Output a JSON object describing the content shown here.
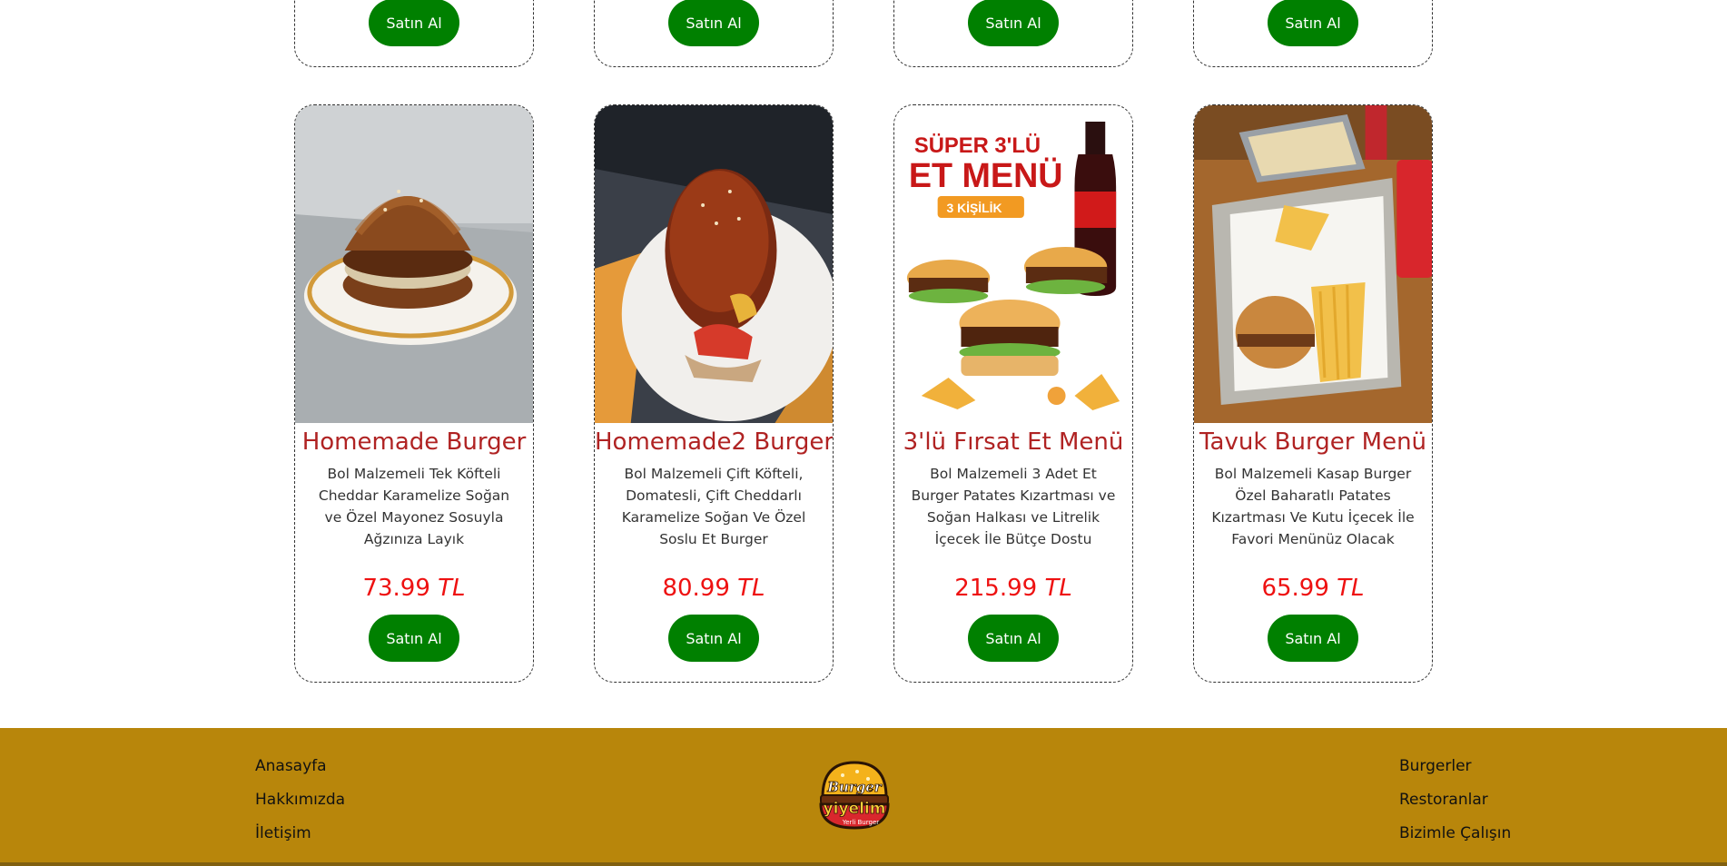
{
  "top_cards": [
    {
      "button": "Satın Al"
    },
    {
      "button": "Satın Al"
    },
    {
      "button": "Satın Al"
    },
    {
      "button": "Satın Al"
    }
  ],
  "products": [
    {
      "title": "Homemade Burger",
      "description": "Bol Malzemeli Tek Köfteli Cheddar Karamelize Soğan ve Özel Mayonez Sosuyla Ağzınıza Layık",
      "price": "73.99",
      "currency": "TL",
      "button": "Satın Al"
    },
    {
      "title": "Homemade2 Burger",
      "description": "Bol Malzemeli Çift Köfteli, Domatesli, Çift Cheddarlı Karamelize Soğan Ve Özel Soslu Et Burger",
      "price": "80.99",
      "currency": "TL",
      "button": "Satın Al"
    },
    {
      "title": "3'lü Fırsat Et Menü",
      "description": "Bol Malzemeli 3 Adet Et Burger Patates Kızartması ve Soğan Halkası ve Litrelik İçecek İle Bütçe Dostu",
      "price": "215.99",
      "currency": "TL",
      "button": "Satın Al",
      "image_text": {
        "line1": "SÜPER 3'LÜ",
        "line2": "ET MENÜ",
        "line3": "3 KİŞİLİK"
      }
    },
    {
      "title": "Tavuk Burger Menü",
      "description": "Bol Malzemeli Kasap Burger Özel Baharatlı Patates Kızartması Ve Kutu İçecek İle Favori Menünüz Olacak",
      "price": "65.99",
      "currency": "TL",
      "button": "Satın Al"
    }
  ],
  "footer": {
    "left_links": [
      "Anasayfa",
      "Hakkımızda",
      "İletişim"
    ],
    "right_links": [
      "Burgerler",
      "Restoranlar",
      "Bizimle Çalışın"
    ],
    "logo": {
      "line1": "Burger",
      "line2": "yiyelim",
      "tagline": "Yerli Burger"
    }
  },
  "colors": {
    "title": "#b02323",
    "price": "#e11111",
    "button": "#008000",
    "footer": "#b8860b"
  }
}
